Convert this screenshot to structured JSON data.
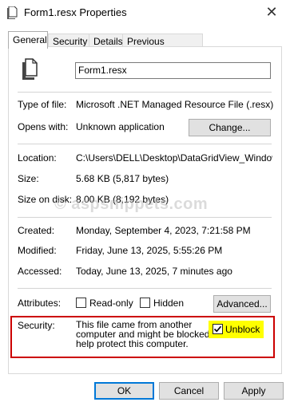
{
  "window": {
    "title": "Form1.resx Properties",
    "close_glyph": "✕"
  },
  "tabs": [
    {
      "label": "General"
    },
    {
      "label": "Security"
    },
    {
      "label": "Details"
    },
    {
      "label": "Previous Versions"
    }
  ],
  "general": {
    "file_name": "Form1.resx",
    "type_of_file_label": "Type of file:",
    "type_of_file_value": "Microsoft .NET Managed Resource File (.resx)",
    "opens_with_label": "Opens with:",
    "opens_with_value": "Unknown application",
    "change_button": "Change...",
    "location_label": "Location:",
    "location_value": "C:\\Users\\DELL\\Desktop\\DataGridView_Windows\\I",
    "size_label": "Size:",
    "size_value": "5.68 KB (5,817 bytes)",
    "size_on_disk_label": "Size on disk:",
    "size_on_disk_value": "8.00 KB (8,192 bytes)",
    "created_label": "Created:",
    "created_value": "Monday, September 4, 2023, 7:21:58 PM",
    "modified_label": "Modified:",
    "modified_value": "Friday, June 13, 2025, 5:55:26 PM",
    "accessed_label": "Accessed:",
    "accessed_value": "Today, June 13, 2025, 7 minutes ago",
    "attributes_label": "Attributes:",
    "readonly_label": "Read-only",
    "readonly_checked": false,
    "hidden_label": "Hidden",
    "hidden_checked": false,
    "advanced_button": "Advanced...",
    "security_label": "Security:",
    "security_text_1": "This file came from another",
    "security_text_2": "computer and might be blocked to",
    "security_text_3": "help protect this computer.",
    "unblock_label": "Unblock",
    "unblock_checked": true
  },
  "watermark": "© aspsnippets.com",
  "buttons": {
    "ok": "OK",
    "cancel": "Cancel",
    "apply": "Apply"
  },
  "colors": {
    "accent": "#0078d7",
    "highlight": "#ffff00",
    "security_border": "#cc0000"
  }
}
